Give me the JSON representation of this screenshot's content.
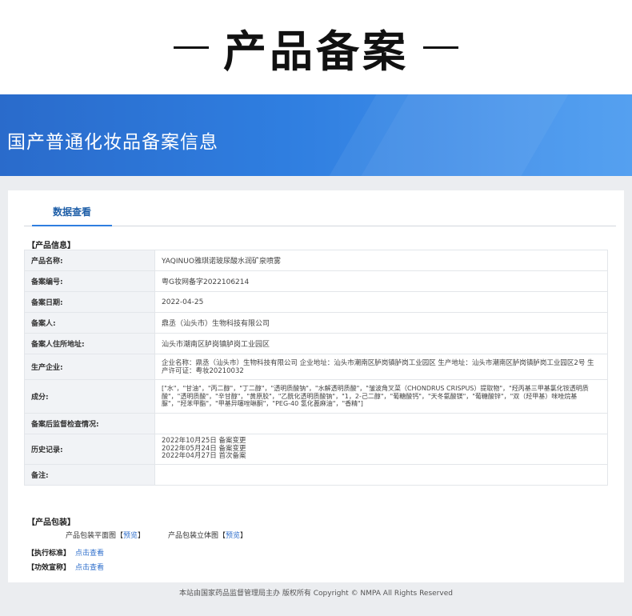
{
  "header": {
    "title": "产品备案"
  },
  "banner": {
    "title": "国产普通化妆品备案信息"
  },
  "tabs": [
    {
      "label": "数据查看"
    }
  ],
  "product_info": {
    "section_label": "【产品信息】",
    "rows": [
      {
        "label": "产品名称:",
        "value": "YAQINUO雅琪诺玻尿酸水润矿泉喷雾"
      },
      {
        "label": "备案编号:",
        "value": "粤G妆网备字2022106214"
      },
      {
        "label": "备案日期:",
        "value": "2022-04-25"
      },
      {
        "label": "备案人:",
        "value": "鼎丞（汕头市）生物科技有限公司"
      },
      {
        "label": "备案人住所地址:",
        "value": "汕头市潮南区胪岗镇胪岗工业园区"
      },
      {
        "label": "生产企业:",
        "value": "企业名称：鼎丞（汕头市）生物科技有限公司 企业地址：汕头市潮南区胪岗镇胪岗工业园区 生产地址：汕头市潮南区胪岗镇胪岗工业园区2号 生产许可证：粤妆20210032"
      },
      {
        "label": "成分:",
        "value": "[\"水\"，\"甘油\"，\"丙二醇\"，\"丁二醇\"，\"透明质酸钠\"，\"水解透明质酸\"，\"皱波角叉菜（CHONDRUS CRISPUS）提取物\"，\"羟丙基三甲基氯化铵透明质酸\"，\"透明质酸\"，\"辛甘醇\"，\"黄原胶\"，\"乙酰化透明质酸钠\"，\"1，2-己二醇\"，\"葡糖酸钙\"，\"天冬氨酸镁\"，\"葡糖酸锌\"，\"双（羟甲基）咪唑烷基脲\"，\"羟苯甲酯\"，\"甲基异噻唑啉酮\"，\"PEG-40 氢化蓖麻油\"，\"香精\"]"
      },
      {
        "label": "备案后监督检查情况:",
        "value": ""
      },
      {
        "label": "历史记录:",
        "lines": [
          "2022年10月25日 备案变更",
          "2022年05月24日 备案变更",
          "2022年04月27日 首次备案"
        ]
      },
      {
        "label": "备注:",
        "value": ""
      }
    ]
  },
  "packaging": {
    "section_label": "【产品包装】",
    "items": [
      {
        "label": "产品包装平面图",
        "bracket_open": "【",
        "link": "预览",
        "bracket_close": "】"
      },
      {
        "label": "产品包装立体图",
        "bracket_open": "【",
        "link": "预览",
        "bracket_close": "】"
      }
    ]
  },
  "standards": [
    {
      "label": "【执行标准】",
      "link": "点击查看"
    },
    {
      "label": "【功效宣称】",
      "link": "点击查看"
    }
  ],
  "footer": {
    "text": "本站由国家药品监督管理局主办 版权所有 Copyright © NMPA All Rights Reserved"
  }
}
